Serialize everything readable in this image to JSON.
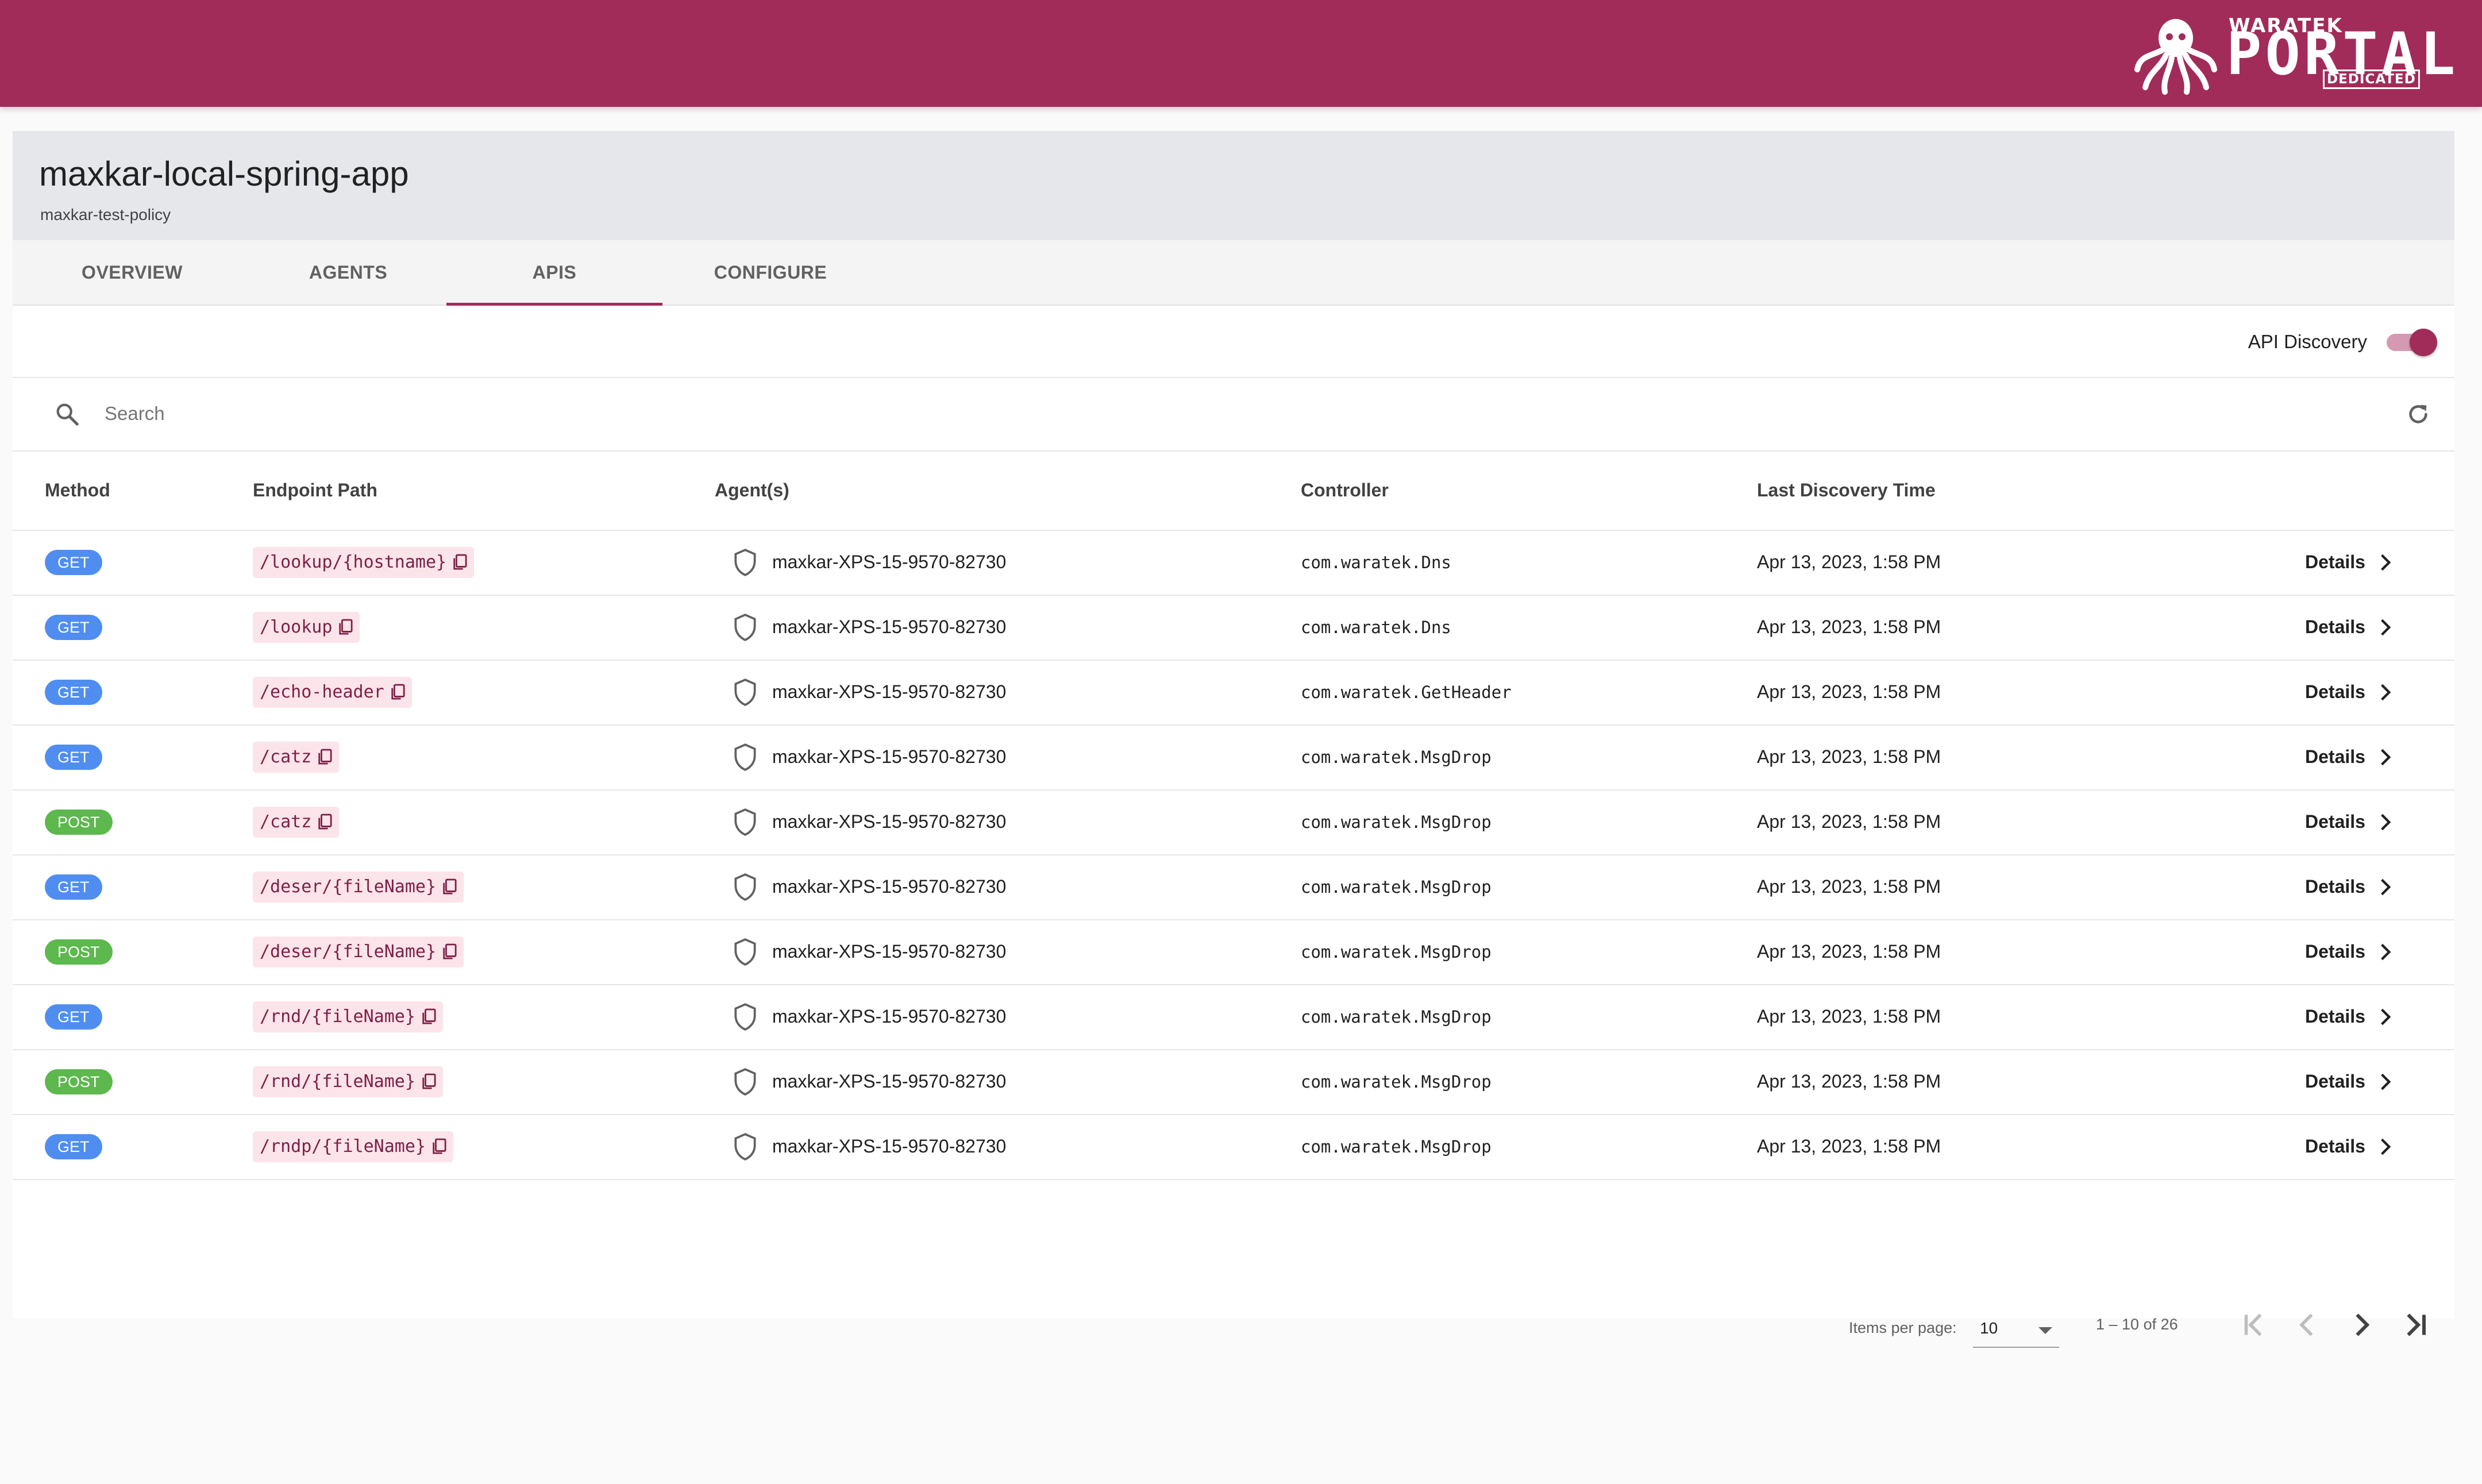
{
  "brand": {
    "top_text": "WARATEK",
    "main_text": "PORTAL",
    "badge_text": "DEDICATED",
    "bar_color": "#a12c59"
  },
  "app": {
    "title": "maxkar-local-spring-app",
    "policy": "maxkar-test-policy"
  },
  "tabs": [
    {
      "label": "OVERVIEW",
      "active": false
    },
    {
      "label": "AGENTS",
      "active": false
    },
    {
      "label": "APIS",
      "active": true
    },
    {
      "label": "CONFIGURE",
      "active": false
    }
  ],
  "discovery": {
    "label": "API Discovery",
    "enabled": true
  },
  "search": {
    "placeholder": "Search",
    "icon": "search-icon",
    "refresh_icon": "refresh-icon"
  },
  "table": {
    "columns": [
      "Method",
      "Endpoint Path",
      "Agent(s)",
      "Controller",
      "Last Discovery Time"
    ],
    "details_label": "Details",
    "rows": [
      {
        "method": "GET",
        "path": "/lookup/{hostname}",
        "agent": "maxkar-XPS-15-9570-82730",
        "controller": "com.waratek.Dns",
        "time": "Apr 13, 2023, 1:58 PM"
      },
      {
        "method": "GET",
        "path": "/lookup",
        "agent": "maxkar-XPS-15-9570-82730",
        "controller": "com.waratek.Dns",
        "time": "Apr 13, 2023, 1:58 PM"
      },
      {
        "method": "GET",
        "path": "/echo-header",
        "agent": "maxkar-XPS-15-9570-82730",
        "controller": "com.waratek.GetHeader",
        "time": "Apr 13, 2023, 1:58 PM"
      },
      {
        "method": "GET",
        "path": "/catz",
        "agent": "maxkar-XPS-15-9570-82730",
        "controller": "com.waratek.MsgDrop",
        "time": "Apr 13, 2023, 1:58 PM"
      },
      {
        "method": "POST",
        "path": "/catz",
        "agent": "maxkar-XPS-15-9570-82730",
        "controller": "com.waratek.MsgDrop",
        "time": "Apr 13, 2023, 1:58 PM"
      },
      {
        "method": "GET",
        "path": "/deser/{fileName}",
        "agent": "maxkar-XPS-15-9570-82730",
        "controller": "com.waratek.MsgDrop",
        "time": "Apr 13, 2023, 1:58 PM"
      },
      {
        "method": "POST",
        "path": "/deser/{fileName}",
        "agent": "maxkar-XPS-15-9570-82730",
        "controller": "com.waratek.MsgDrop",
        "time": "Apr 13, 2023, 1:58 PM"
      },
      {
        "method": "GET",
        "path": "/rnd/{fileName}",
        "agent": "maxkar-XPS-15-9570-82730",
        "controller": "com.waratek.MsgDrop",
        "time": "Apr 13, 2023, 1:58 PM"
      },
      {
        "method": "POST",
        "path": "/rnd/{fileName}",
        "agent": "maxkar-XPS-15-9570-82730",
        "controller": "com.waratek.MsgDrop",
        "time": "Apr 13, 2023, 1:58 PM"
      },
      {
        "method": "GET",
        "path": "/rndp/{fileName}",
        "agent": "maxkar-XPS-15-9570-82730",
        "controller": "com.waratek.MsgDrop",
        "time": "Apr 13, 2023, 1:58 PM"
      }
    ]
  },
  "paginator": {
    "items_label": "Items per page:",
    "page_size": "10",
    "range": "1 – 10 of 26"
  },
  "colors": {
    "accent": "#a12c59",
    "get": "#4f8ef0",
    "post": "#5db84e",
    "chip_bg": "#fbe4ea",
    "chip_text": "#7e1f45"
  }
}
